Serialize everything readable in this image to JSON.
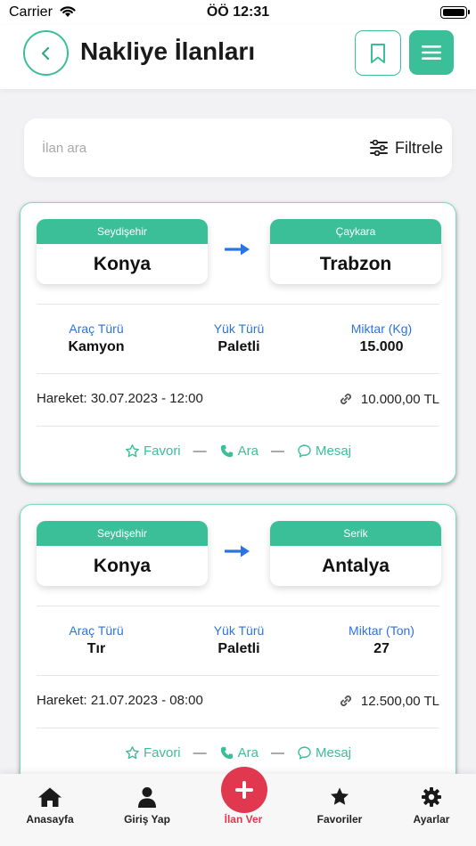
{
  "status": {
    "carrier": "Carrier",
    "time": "ÖÖ 12:31"
  },
  "header": {
    "title": "Nakliye İlanları"
  },
  "search": {
    "placeholder": "İlan ara",
    "filter_label": "Filtrele"
  },
  "listings": [
    {
      "from": {
        "district": "Seydişehir",
        "city": "Konya"
      },
      "to": {
        "district": "Çaykara",
        "city": "Trabzon"
      },
      "vehicle_label": "Araç Türü",
      "vehicle": "Kamyon",
      "load_label": "Yük Türü",
      "load": "Paletli",
      "amount_label": "Miktar (Kg)",
      "amount": "15.000",
      "departure": "Hareket: 30.07.2023 - 12:00",
      "price": "10.000,00 TL",
      "favorite": "Favori",
      "call": "Ara",
      "message": "Mesaj"
    },
    {
      "from": {
        "district": "Seydişehir",
        "city": "Konya"
      },
      "to": {
        "district": "Serik",
        "city": "Antalya"
      },
      "vehicle_label": "Araç Türü",
      "vehicle": "Tır",
      "load_label": "Yük Türü",
      "load": "Paletli",
      "amount_label": "Miktar (Ton)",
      "amount": "27",
      "departure": "Hareket: 21.07.2023 - 08:00",
      "price": "12.500,00 TL",
      "favorite": "Favori",
      "call": "Ara",
      "message": "Mesaj"
    }
  ],
  "tabs": [
    {
      "label": "Anasayfa",
      "icon": "home-icon"
    },
    {
      "label": "Giriş Yap",
      "icon": "user-icon"
    },
    {
      "label": "İlan Ver",
      "icon": "plus-icon"
    },
    {
      "label": "Favoriler",
      "icon": "star-icon"
    },
    {
      "label": "Ayarlar",
      "icon": "gear-icon"
    }
  ],
  "colors": {
    "accent": "#3bbf99",
    "fab": "#e0394f",
    "label_blue": "#2b73e0"
  }
}
